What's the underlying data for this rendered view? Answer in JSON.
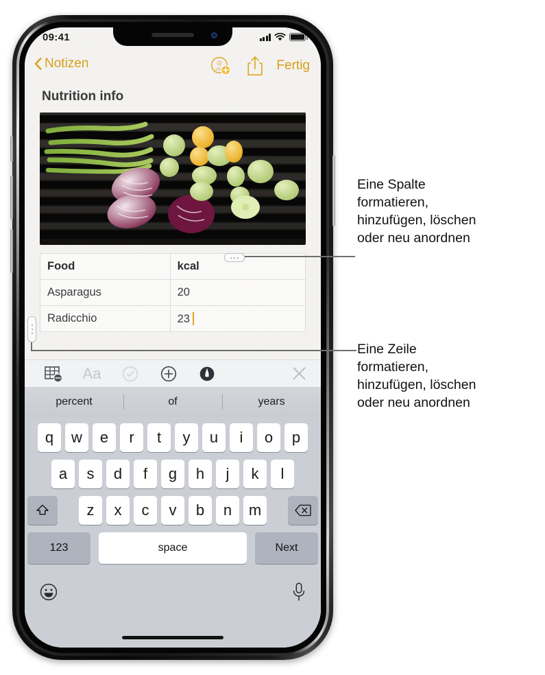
{
  "status_bar": {
    "time": "09:41",
    "signal_icon": "cellular-signal-icon",
    "wifi_icon": "wifi-icon",
    "battery_icon": "battery-full-icon"
  },
  "nav_bar": {
    "back_label": "Notizen",
    "back_icon": "chevron-left-icon",
    "add_person_icon": "add-person-icon",
    "share_icon": "share-icon",
    "done_label": "Fertig",
    "accent_color": "#d79f19"
  },
  "note": {
    "title": "Nutrition info",
    "photo_alt": "grilled-vegetables-photo",
    "table": {
      "headers": [
        "Food",
        "kcal"
      ],
      "rows": [
        [
          "Asparagus",
          "20"
        ],
        [
          "Radicchio",
          "23"
        ]
      ],
      "caret_color": "#e0a51f",
      "column_handle_icon": "column-handle-icon",
      "row_handle_icon": "row-handle-icon"
    }
  },
  "format_toolbar": {
    "items": [
      {
        "icon": "table-options-icon",
        "enabled": true
      },
      {
        "icon": "text-format-icon",
        "label": "Aa",
        "enabled": false
      },
      {
        "icon": "checklist-icon",
        "enabled": false
      },
      {
        "icon": "add-attachment-icon",
        "enabled": true
      },
      {
        "icon": "markup-pen-icon",
        "enabled": true
      }
    ],
    "close_icon": "close-icon"
  },
  "predictive_bar": {
    "suggestions": [
      "percent",
      "of",
      "years"
    ]
  },
  "keyboard": {
    "row1": [
      "q",
      "w",
      "e",
      "r",
      "t",
      "y",
      "u",
      "i",
      "o",
      "p"
    ],
    "row2": [
      "a",
      "s",
      "d",
      "f",
      "g",
      "h",
      "j",
      "k",
      "l"
    ],
    "row3": [
      "z",
      "x",
      "c",
      "v",
      "b",
      "n",
      "m"
    ],
    "shift_icon": "shift-icon",
    "delete_icon": "backspace-icon",
    "numbers_label": "123",
    "space_label": "space",
    "return_label": "Next",
    "emoji_icon": "emoji-smiley-icon",
    "dictation_icon": "microphone-icon"
  },
  "callouts": [
    {
      "id": "column-callout",
      "lines": [
        "Eine Spalte",
        "formatieren,",
        "hinzufügen, löschen",
        "oder neu anordnen"
      ]
    },
    {
      "id": "row-callout",
      "lines": [
        "Eine Zeile",
        "formatieren,",
        "hinzufügen, löschen",
        "oder neu anordnen"
      ]
    }
  ]
}
